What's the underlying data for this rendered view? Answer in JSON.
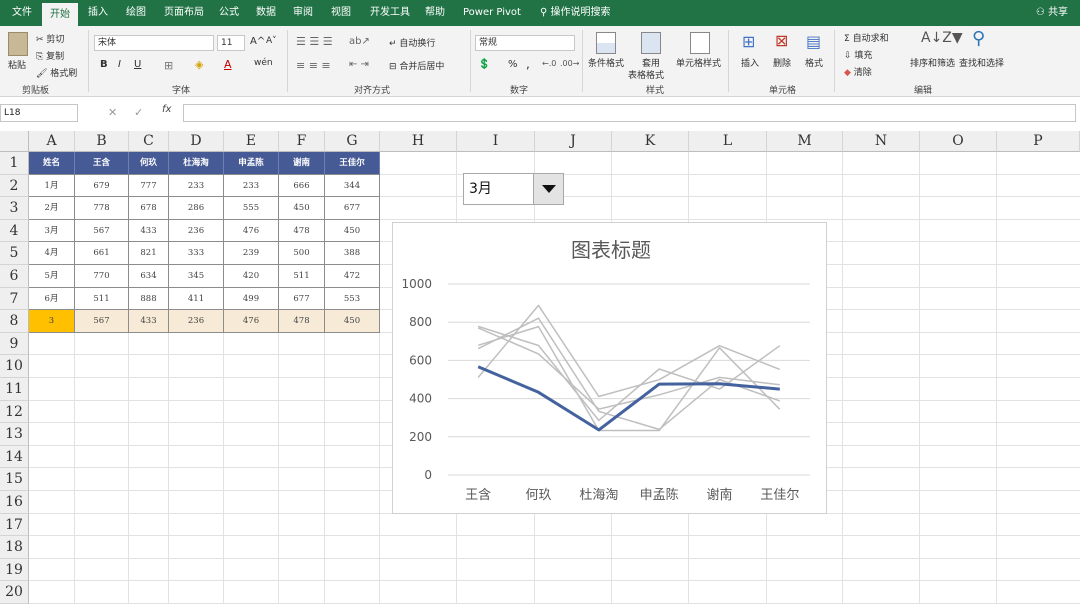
{
  "ribbon": {
    "tabs": [
      "文件",
      "开始",
      "插入",
      "绘图",
      "页面布局",
      "公式",
      "数据",
      "审阅",
      "视图",
      "开发工具",
      "帮助",
      "Power Pivot",
      "操作说明搜索"
    ],
    "active_tab": "开始",
    "share": "共享",
    "clipboard": {
      "paste": "粘贴",
      "cut": "剪切",
      "copy": "复制",
      "format_painter": "格式刷",
      "group": "剪贴板"
    },
    "font": {
      "name": "宋体",
      "size": "11",
      "grow": "A^",
      "shrink": "A˅",
      "bold": "B",
      "italic": "I",
      "underline": "U",
      "group": "字体",
      "wen": "wén"
    },
    "alignment": {
      "wrap": "自动换行",
      "merge": "合并后居中",
      "group": "对齐方式"
    },
    "number": {
      "format": "常规",
      "percent": "%",
      "comma": ",",
      "group": "数字"
    },
    "styles": {
      "conditional": "条件格式",
      "table_format_1": "套用",
      "table_format_2": "表格格式",
      "cell_style": "单元格样式",
      "group": "样式"
    },
    "cells": {
      "insert": "插入",
      "delete": "删除",
      "format": "格式",
      "group": "单元格"
    },
    "editing": {
      "autosum": "自动求和",
      "fill": "填充",
      "clear": "清除",
      "sort": "排序和筛选",
      "find": "查找和选择",
      "group": "编辑"
    }
  },
  "formula_bar": {
    "name_box": "L18",
    "fx": "fx",
    "content": ""
  },
  "columns": [
    "A",
    "B",
    "C",
    "D",
    "E",
    "F",
    "G",
    "H",
    "I",
    "J",
    "K",
    "L",
    "M",
    "N",
    "O",
    "P"
  ],
  "rows": [
    "1",
    "2",
    "3",
    "4",
    "5",
    "6",
    "7",
    "8",
    "9",
    "10",
    "11",
    "12",
    "13",
    "14",
    "15",
    "16",
    "17",
    "18",
    "19",
    "20"
  ],
  "table": {
    "header": [
      "姓名",
      "王含",
      "何玖",
      "杜海淘",
      "申孟陈",
      "谢南",
      "王佳尔"
    ],
    "body": [
      [
        "1月",
        "679",
        "777",
        "233",
        "233",
        "666",
        "344"
      ],
      [
        "2月",
        "778",
        "678",
        "286",
        "555",
        "450",
        "677"
      ],
      [
        "3月",
        "567",
        "433",
        "236",
        "476",
        "478",
        "450"
      ],
      [
        "4月",
        "661",
        "821",
        "333",
        "239",
        "500",
        "388"
      ],
      [
        "5月",
        "770",
        "634",
        "345",
        "420",
        "511",
        "472"
      ],
      [
        "6月",
        "511",
        "888",
        "411",
        "499",
        "677",
        "553"
      ]
    ],
    "selected_row": [
      "3",
      "567",
      "433",
      "236",
      "476",
      "478",
      "450"
    ]
  },
  "dropdown": {
    "value": "3月"
  },
  "chart_data": {
    "type": "line",
    "title": "图表标题",
    "categories": [
      "王含",
      "何玖",
      "杜海淘",
      "申孟陈",
      "谢南",
      "王佳尔"
    ],
    "series": [
      {
        "values": [
          679,
          777,
          233,
          233,
          666,
          344
        ],
        "color": "#bfbfbf"
      },
      {
        "values": [
          778,
          678,
          286,
          555,
          450,
          677
        ],
        "color": "#bfbfbf"
      },
      {
        "values": [
          567,
          433,
          236,
          476,
          478,
          450
        ],
        "color": "#bfbfbf"
      },
      {
        "values": [
          661,
          821,
          333,
          239,
          500,
          388
        ],
        "color": "#bfbfbf"
      },
      {
        "values": [
          770,
          634,
          345,
          420,
          511,
          472
        ],
        "color": "#bfbfbf"
      },
      {
        "values": [
          511,
          888,
          411,
          499,
          677,
          553
        ],
        "color": "#bfbfbf"
      },
      {
        "values": [
          567,
          433,
          236,
          476,
          478,
          450
        ],
        "color": "#44629e",
        "highlight": true
      }
    ],
    "ylim": [
      0,
      1000
    ],
    "yticks": [
      "0",
      "200",
      "400",
      "600",
      "800",
      "1000"
    ],
    "grid": true
  },
  "colors": {
    "excel_green": "#217346",
    "header_fill": "#465a96",
    "selected_fill": "#f7ebd8",
    "accent_cell": "#ffc000",
    "highlight_line": "#44629e"
  }
}
